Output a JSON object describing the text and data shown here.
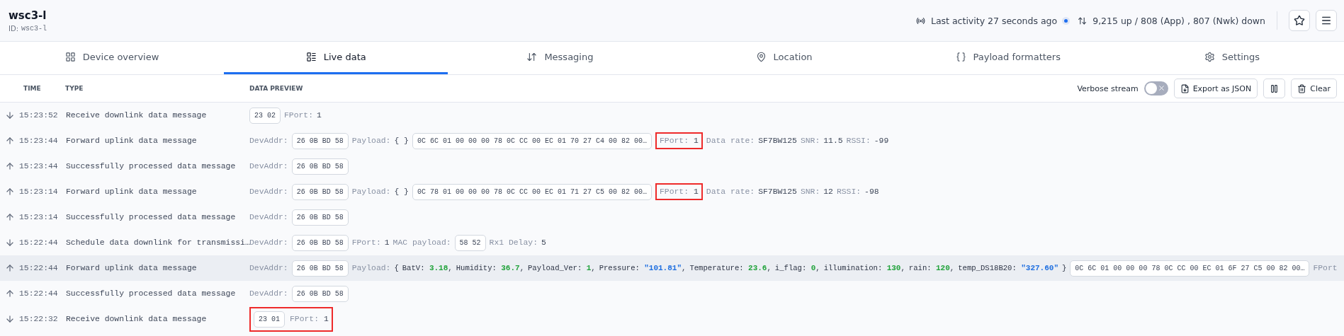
{
  "device": {
    "name": "wsc3-l",
    "id_label": "ID:",
    "id": "wsc3-l"
  },
  "activity": {
    "text": "Last activity 27 seconds ago",
    "live": true,
    "counts": "9,215 up / 808 (App) , 807 (Nwk) down"
  },
  "tabs": [
    {
      "label": "Device overview",
      "selected": false
    },
    {
      "label": "Live data",
      "selected": true
    },
    {
      "label": "Messaging",
      "selected": false
    },
    {
      "label": "Location",
      "selected": false
    },
    {
      "label": "Payload formatters",
      "selected": false
    },
    {
      "label": "Settings",
      "selected": false
    }
  ],
  "table": {
    "columns": [
      "TIME",
      "TYPE",
      "DATA PREVIEW"
    ],
    "toolbar": {
      "verbose_label": "Verbose stream",
      "verbose_on": false,
      "export_label": "Export as JSON",
      "clear_label": "Clear"
    },
    "rows": [
      {
        "kind": "down",
        "time": "15:23:52",
        "type": "Receive downlink data message",
        "hovered": false,
        "preview": [
          {
            "kind": "chip",
            "text": "23 02"
          },
          {
            "kind": "label",
            "text": "FPort:"
          },
          {
            "kind": "value",
            "text": "1"
          }
        ]
      },
      {
        "kind": "up",
        "time": "15:23:44",
        "type": "Forward uplink data message",
        "hovered": false,
        "preview": [
          {
            "kind": "label",
            "text": "DevAddr:"
          },
          {
            "kind": "chip",
            "text": "26 0B BD 58"
          },
          {
            "kind": "label",
            "text": "Payload:"
          },
          {
            "kind": "value",
            "text": "{ }"
          },
          {
            "kind": "chip",
            "text": "0C 6C 01 00 00 00 78 0C CC 00 EC 01 70 27 C4 00 82 00…"
          },
          {
            "kind": "group",
            "flagged": true,
            "items": [
              {
                "kind": "label",
                "text": "FPort:"
              },
              {
                "kind": "value",
                "text": "1"
              }
            ]
          },
          {
            "kind": "label",
            "text": "Data rate:"
          },
          {
            "kind": "value",
            "text": "SF7BW125"
          },
          {
            "kind": "label",
            "text": "SNR:"
          },
          {
            "kind": "value",
            "text": "11.5"
          },
          {
            "kind": "label",
            "text": "RSSI:"
          },
          {
            "kind": "value",
            "text": "-99"
          }
        ]
      },
      {
        "kind": "up",
        "time": "15:23:44",
        "type": "Successfully processed data message",
        "hovered": false,
        "preview": [
          {
            "kind": "label",
            "text": "DevAddr:"
          },
          {
            "kind": "chip",
            "text": "26 0B BD 58"
          }
        ]
      },
      {
        "kind": "up",
        "time": "15:23:14",
        "type": "Forward uplink data message",
        "hovered": false,
        "preview": [
          {
            "kind": "label",
            "text": "DevAddr:"
          },
          {
            "kind": "chip",
            "text": "26 0B BD 58"
          },
          {
            "kind": "label",
            "text": "Payload:"
          },
          {
            "kind": "value",
            "text": "{ }"
          },
          {
            "kind": "chip",
            "text": "0C 78 01 00 00 00 78 0C CC 00 EC 01 71 27 C5 00 82 00…"
          },
          {
            "kind": "group",
            "flagged": true,
            "items": [
              {
                "kind": "label",
                "text": "FPort:"
              },
              {
                "kind": "value",
                "text": "1"
              }
            ]
          },
          {
            "kind": "label",
            "text": "Data rate:"
          },
          {
            "kind": "value",
            "text": "SF7BW125"
          },
          {
            "kind": "label",
            "text": "SNR:"
          },
          {
            "kind": "value",
            "text": "12"
          },
          {
            "kind": "label",
            "text": "RSSI:"
          },
          {
            "kind": "value",
            "text": "-98"
          }
        ]
      },
      {
        "kind": "up",
        "time": "15:23:14",
        "type": "Successfully processed data message",
        "hovered": false,
        "preview": [
          {
            "kind": "label",
            "text": "DevAddr:"
          },
          {
            "kind": "chip",
            "text": "26 0B BD 58"
          }
        ]
      },
      {
        "kind": "down",
        "time": "15:22:44",
        "type": "Schedule data downlink for transmissi…",
        "hovered": false,
        "preview": [
          {
            "kind": "label",
            "text": "DevAddr:"
          },
          {
            "kind": "chip",
            "text": "26 0B BD 58"
          },
          {
            "kind": "label",
            "text": "FPort:"
          },
          {
            "kind": "value",
            "text": "1"
          },
          {
            "kind": "label",
            "text": "MAC payload:"
          },
          {
            "kind": "chip",
            "text": "58 52"
          },
          {
            "kind": "label",
            "text": "Rx1 Delay:"
          },
          {
            "kind": "value",
            "text": "5"
          }
        ]
      },
      {
        "kind": "up",
        "time": "15:22:44",
        "type": "Forward uplink data message",
        "hovered": true,
        "preview": [
          {
            "kind": "label",
            "text": "DevAddr:"
          },
          {
            "kind": "chip",
            "text": "26 0B BD 58"
          },
          {
            "kind": "label",
            "text": "Payload:"
          },
          {
            "kind": "object",
            "open": "{",
            "close": "}",
            "entries": [
              {
                "key": "BatV:",
                "value": "3.18",
                "color": "#22a33c",
                "sep": ","
              },
              {
                "key": "Humidity:",
                "value": "36.7",
                "color": "#22a33c",
                "sep": ","
              },
              {
                "key": "Payload_Ver:",
                "value": "1",
                "color": "#22a33c",
                "sep": ","
              },
              {
                "key": "Pressure:",
                "value": "\"101.81\"",
                "color": "#1f6fe0",
                "sep": ","
              },
              {
                "key": "Temperature:",
                "value": "23.6",
                "color": "#22a33c",
                "sep": ","
              },
              {
                "key": "i_flag:",
                "value": "0",
                "color": "#22a33c",
                "sep": ","
              },
              {
                "key": "illumination:",
                "value": "130",
                "color": "#22a33c",
                "sep": ","
              },
              {
                "key": "rain:",
                "value": "120",
                "color": "#22a33c",
                "sep": ","
              },
              {
                "key": "temp_DS18B20:",
                "value": "\"327.60\"",
                "color": "#1f6fe0"
              }
            ]
          },
          {
            "kind": "chip",
            "text": "0C 6C 01 00 00 00 78 0C CC 00 EC 01 6F 27 C5 00 82 00…"
          },
          {
            "kind": "label",
            "text": "FPort"
          }
        ]
      },
      {
        "kind": "up",
        "time": "15:22:44",
        "type": "Successfully processed data message",
        "hovered": false,
        "preview": [
          {
            "kind": "label",
            "text": "DevAddr:"
          },
          {
            "kind": "chip",
            "text": "26 0B BD 58"
          }
        ]
      },
      {
        "kind": "down",
        "time": "15:22:32",
        "type": "Receive downlink data message",
        "hovered": false,
        "preview": [
          {
            "kind": "group",
            "flagged": true,
            "items": [
              {
                "kind": "chip",
                "text": "23 01"
              },
              {
                "kind": "label",
                "text": "FPort:"
              },
              {
                "kind": "value",
                "text": "1"
              }
            ]
          }
        ]
      }
    ]
  }
}
